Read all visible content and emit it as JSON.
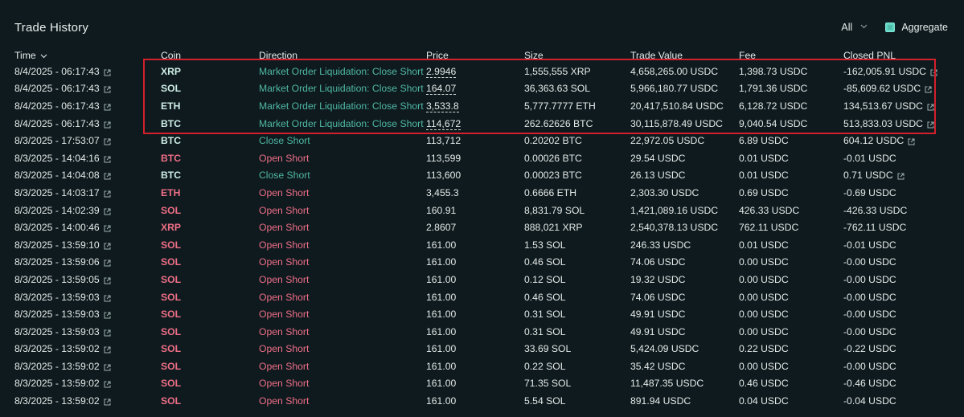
{
  "panel": {
    "title": "Trade History",
    "filter_value": "All",
    "aggregate_label": "Aggregate",
    "aggregate_checked": true
  },
  "columns": [
    "Time",
    "Coin",
    "Direction",
    "Price",
    "Size",
    "Trade Value",
    "Fee",
    "Closed PNL"
  ],
  "colors": {
    "background": "#0f1a1f",
    "open_short": "#ee6f86",
    "close_short": "#4fb8a2",
    "highlight_box": "#d2202c",
    "checkbox": "#5fd8c4"
  },
  "rows": [
    {
      "time": "8/4/2025 - 06:17:43",
      "coin": "XRP",
      "direction": "Market Order Liquidation: Close Short",
      "price": "2.9946",
      "size": "1,555,555 XRP",
      "trade_value": "4,658,265.00 USDC",
      "fee": "1,398.73 USDC",
      "pnl": "-162,005.91 USDC",
      "pnl_link": true,
      "coin_class": "long-coin",
      "dir_class": "liq",
      "price_dotted": true
    },
    {
      "time": "8/4/2025 - 06:17:43",
      "coin": "SOL",
      "direction": "Market Order Liquidation: Close Short",
      "price": "164.07",
      "size": "36,363.63 SOL",
      "trade_value": "5,966,180.77 USDC",
      "fee": "1,791.36 USDC",
      "pnl": "-85,609.62 USDC",
      "pnl_link": true,
      "coin_class": "long-coin",
      "dir_class": "liq",
      "price_dotted": true
    },
    {
      "time": "8/4/2025 - 06:17:43",
      "coin": "ETH",
      "direction": "Market Order Liquidation: Close Short",
      "price": "3,533.8",
      "size": "5,777.7777 ETH",
      "trade_value": "20,417,510.84 USDC",
      "fee": "6,128.72 USDC",
      "pnl": "134,513.67 USDC",
      "pnl_link": true,
      "coin_class": "long-coin",
      "dir_class": "liq",
      "price_dotted": true
    },
    {
      "time": "8/4/2025 - 06:17:43",
      "coin": "BTC",
      "direction": "Market Order Liquidation: Close Short",
      "price": "114,672",
      "size": "262.62626 BTC",
      "trade_value": "30,115,878.49 USDC",
      "fee": "9,040.54 USDC",
      "pnl": "513,833.03 USDC",
      "pnl_link": true,
      "coin_class": "long-coin",
      "dir_class": "liq",
      "price_dotted": true
    },
    {
      "time": "8/3/2025 - 17:53:07",
      "coin": "BTC",
      "direction": "Close Short",
      "price": "113,712",
      "size": "0.20202 BTC",
      "trade_value": "22,972.05 USDC",
      "fee": "6.89 USDC",
      "pnl": "604.12 USDC",
      "pnl_link": true,
      "coin_class": "long-coin",
      "dir_class": "close",
      "price_dotted": false
    },
    {
      "time": "8/3/2025 - 14:04:16",
      "coin": "BTC",
      "direction": "Open Short",
      "price": "113,599",
      "size": "0.00026 BTC",
      "trade_value": "29.54 USDC",
      "fee": "0.01 USDC",
      "pnl": "-0.01 USDC",
      "pnl_link": false,
      "coin_class": "short",
      "dir_class": "short",
      "price_dotted": false
    },
    {
      "time": "8/3/2025 - 14:04:08",
      "coin": "BTC",
      "direction": "Close Short",
      "price": "113,600",
      "size": "0.00023 BTC",
      "trade_value": "26.13 USDC",
      "fee": "0.01 USDC",
      "pnl": "0.71 USDC",
      "pnl_link": true,
      "coin_class": "long-coin",
      "dir_class": "close",
      "price_dotted": false
    },
    {
      "time": "8/3/2025 - 14:03:17",
      "coin": "ETH",
      "direction": "Open Short",
      "price": "3,455.3",
      "size": "0.6666 ETH",
      "trade_value": "2,303.30 USDC",
      "fee": "0.69 USDC",
      "pnl": "-0.69 USDC",
      "pnl_link": false,
      "coin_class": "short",
      "dir_class": "short",
      "price_dotted": false
    },
    {
      "time": "8/3/2025 - 14:02:39",
      "coin": "SOL",
      "direction": "Open Short",
      "price": "160.91",
      "size": "8,831.79 SOL",
      "trade_value": "1,421,089.16 USDC",
      "fee": "426.33 USDC",
      "pnl": "-426.33 USDC",
      "pnl_link": false,
      "coin_class": "short",
      "dir_class": "short",
      "price_dotted": false
    },
    {
      "time": "8/3/2025 - 14:00:46",
      "coin": "XRP",
      "direction": "Open Short",
      "price": "2.8607",
      "size": "888,021 XRP",
      "trade_value": "2,540,378.13 USDC",
      "fee": "762.11 USDC",
      "pnl": "-762.11 USDC",
      "pnl_link": false,
      "coin_class": "short",
      "dir_class": "short",
      "price_dotted": false
    },
    {
      "time": "8/3/2025 - 13:59:10",
      "coin": "SOL",
      "direction": "Open Short",
      "price": "161.00",
      "size": "1.53 SOL",
      "trade_value": "246.33 USDC",
      "fee": "0.01 USDC",
      "pnl": "-0.01 USDC",
      "pnl_link": false,
      "coin_class": "short",
      "dir_class": "short",
      "price_dotted": false
    },
    {
      "time": "8/3/2025 - 13:59:06",
      "coin": "SOL",
      "direction": "Open Short",
      "price": "161.00",
      "size": "0.46 SOL",
      "trade_value": "74.06 USDC",
      "fee": "0.00 USDC",
      "pnl": "-0.00 USDC",
      "pnl_link": false,
      "coin_class": "short",
      "dir_class": "short",
      "price_dotted": false
    },
    {
      "time": "8/3/2025 - 13:59:05",
      "coin": "SOL",
      "direction": "Open Short",
      "price": "161.00",
      "size": "0.12 SOL",
      "trade_value": "19.32 USDC",
      "fee": "0.00 USDC",
      "pnl": "-0.00 USDC",
      "pnl_link": false,
      "coin_class": "short",
      "dir_class": "short",
      "price_dotted": false
    },
    {
      "time": "8/3/2025 - 13:59:03",
      "coin": "SOL",
      "direction": "Open Short",
      "price": "161.00",
      "size": "0.46 SOL",
      "trade_value": "74.06 USDC",
      "fee": "0.00 USDC",
      "pnl": "-0.00 USDC",
      "pnl_link": false,
      "coin_class": "short",
      "dir_class": "short",
      "price_dotted": false
    },
    {
      "time": "8/3/2025 - 13:59:03",
      "coin": "SOL",
      "direction": "Open Short",
      "price": "161.00",
      "size": "0.31 SOL",
      "trade_value": "49.91 USDC",
      "fee": "0.00 USDC",
      "pnl": "-0.00 USDC",
      "pnl_link": false,
      "coin_class": "short",
      "dir_class": "short",
      "price_dotted": false
    },
    {
      "time": "8/3/2025 - 13:59:03",
      "coin": "SOL",
      "direction": "Open Short",
      "price": "161.00",
      "size": "0.31 SOL",
      "trade_value": "49.91 USDC",
      "fee": "0.00 USDC",
      "pnl": "-0.00 USDC",
      "pnl_link": false,
      "coin_class": "short",
      "dir_class": "short",
      "price_dotted": false
    },
    {
      "time": "8/3/2025 - 13:59:02",
      "coin": "SOL",
      "direction": "Open Short",
      "price": "161.00",
      "size": "33.69 SOL",
      "trade_value": "5,424.09 USDC",
      "fee": "0.22 USDC",
      "pnl": "-0.22 USDC",
      "pnl_link": false,
      "coin_class": "short",
      "dir_class": "short",
      "price_dotted": false
    },
    {
      "time": "8/3/2025 - 13:59:02",
      "coin": "SOL",
      "direction": "Open Short",
      "price": "161.00",
      "size": "0.22 SOL",
      "trade_value": "35.42 USDC",
      "fee": "0.00 USDC",
      "pnl": "-0.00 USDC",
      "pnl_link": false,
      "coin_class": "short",
      "dir_class": "short",
      "price_dotted": false
    },
    {
      "time": "8/3/2025 - 13:59:02",
      "coin": "SOL",
      "direction": "Open Short",
      "price": "161.00",
      "size": "71.35 SOL",
      "trade_value": "11,487.35 USDC",
      "fee": "0.46 USDC",
      "pnl": "-0.46 USDC",
      "pnl_link": false,
      "coin_class": "short",
      "dir_class": "short",
      "price_dotted": false
    },
    {
      "time": "8/3/2025 - 13:59:02",
      "coin": "SOL",
      "direction": "Open Short",
      "price": "161.00",
      "size": "5.54 SOL",
      "trade_value": "891.94 USDC",
      "fee": "0.04 USDC",
      "pnl": "-0.04 USDC",
      "pnl_link": false,
      "coin_class": "short",
      "dir_class": "short",
      "price_dotted": false
    }
  ]
}
